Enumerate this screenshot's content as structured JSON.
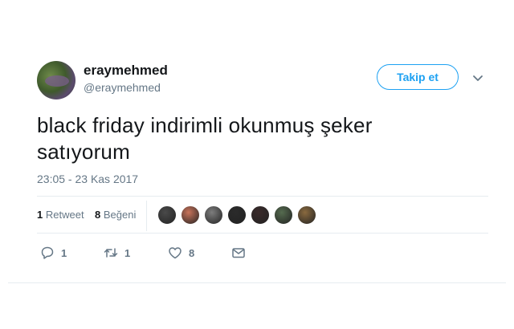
{
  "user": {
    "display_name": "eraymehmed",
    "handle": "@eraymehmed"
  },
  "follow_button": {
    "label": "Takip et"
  },
  "tweet": {
    "text_line1": "black friday indirimli okunmuş şeker",
    "text_line2": "satıyorum",
    "timestamp": "23:05 - 23 Kas 2017"
  },
  "stats": {
    "retweet_count": "1",
    "retweet_label": "Retweet",
    "like_count": "8",
    "like_label": "Beğeni"
  },
  "likers": [
    "#4a4a4a",
    "#c9735a",
    "#7d7d7d",
    "#2b2b2b",
    "#3a2a2a",
    "#556b4f",
    "#8a6a3f"
  ],
  "actions": {
    "reply_count": "1",
    "retweet_count": "1",
    "like_count": "8"
  },
  "icons": {
    "reply": "reply-icon",
    "retweet": "retweet-icon",
    "like": "heart-icon",
    "message": "envelope-icon",
    "more": "chevron-down-icon"
  },
  "colors": {
    "accent": "#1da1f2",
    "secondary_text": "#657786",
    "primary_text": "#14171a",
    "divider": "#e6ecf0"
  }
}
